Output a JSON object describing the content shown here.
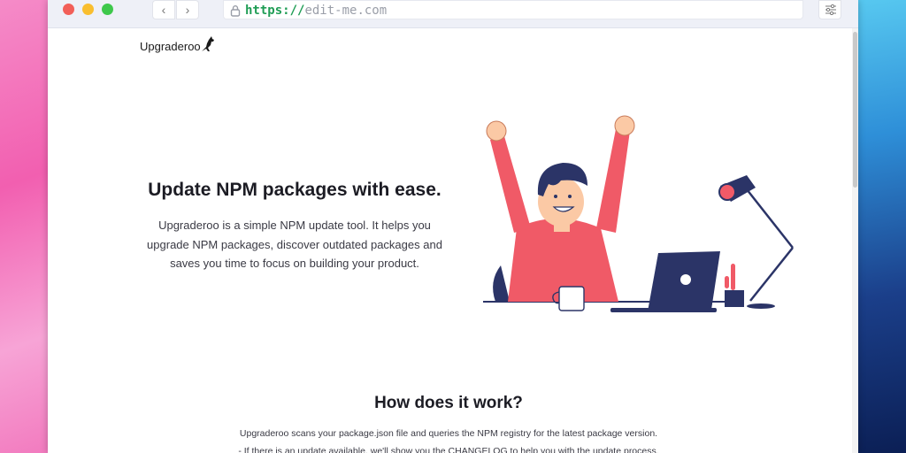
{
  "browser": {
    "url_scheme": "https://",
    "url_host": "edit-me.com",
    "back_glyph": "‹",
    "forward_glyph": "›"
  },
  "site": {
    "logo_text": "Upgraderoo"
  },
  "hero": {
    "title": "Update NPM packages with ease.",
    "description": "Upgraderoo is a simple NPM update tool. It helps you upgrade NPM packages, discover outdated packages and saves you time to focus on building your product."
  },
  "how": {
    "title": "How does it work?",
    "line1": "Upgraderoo scans your package.json file and queries the NPM registry for the latest package version.",
    "line2": "- If there is an update available, we'll show you the CHANGELOG to help you with the update process."
  },
  "icons": {
    "lock": "lock-icon",
    "menu": "sliders-icon",
    "logo": "kangaroo-icon"
  },
  "colors": {
    "accent_red": "#f05a67",
    "navy": "#2b3467",
    "url_scheme": "#1f9d55"
  }
}
